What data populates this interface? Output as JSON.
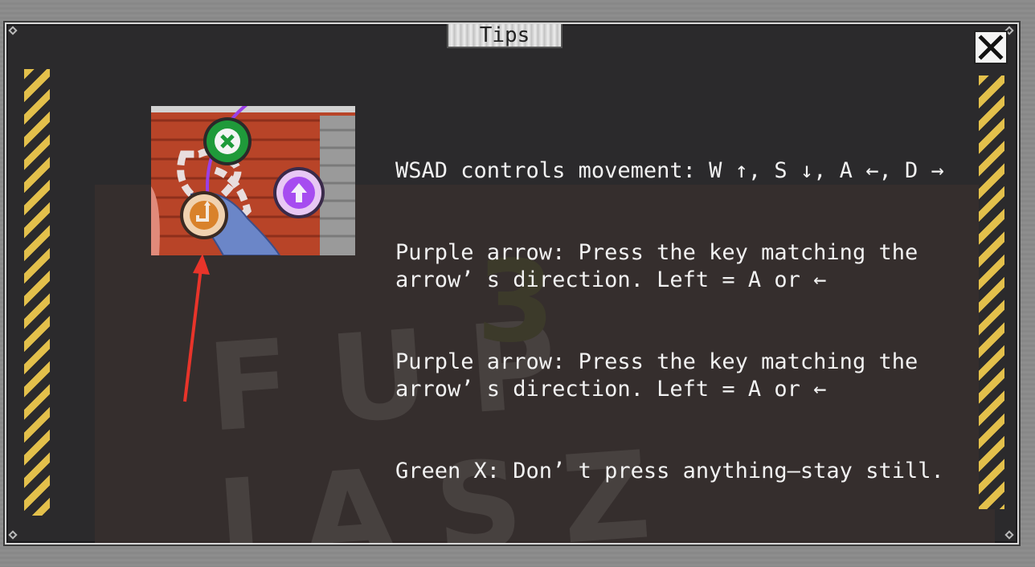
{
  "dialog": {
    "title": "Tips",
    "close_label": "close"
  },
  "tips": {
    "lines": [
      "WSAD controls movement: W ↑, S ↓, A ←, D →",
      "Purple arrow: Press the key matching the arrow’ s direction. Left = A or ←",
      "Purple arrow: Press the key matching the arrow’ s direction. Left = A or ←",
      "Green X: Don’ t press anything—stay still."
    ]
  },
  "icons": {
    "close": "close-icon",
    "green_x": "green-x-icon",
    "purple_arrow": "purple-up-arrow-icon",
    "orange_arrow": "orange-turn-arrow-icon",
    "annotation_arrow": "red-annotation-arrow"
  },
  "colors": {
    "panel_bg": "#2b2a2c",
    "hazard_yellow": "#e3c04b",
    "text": "#f2f2f2",
    "green_icon": "#1f9a3a",
    "purple_icon": "#a64cf0",
    "orange_icon": "#d9822b",
    "annotation_red": "#e8342a"
  }
}
